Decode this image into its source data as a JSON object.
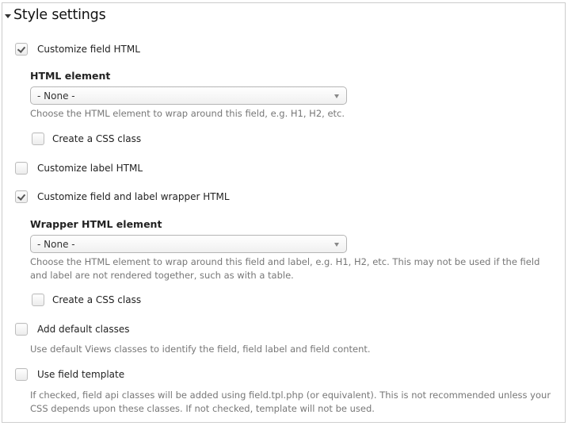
{
  "section": {
    "title": "Style settings",
    "expanded": true
  },
  "customize_field": {
    "label": "Customize field HTML",
    "checked": true,
    "element_label": "HTML element",
    "element_value": "- None -",
    "element_description": "Choose the HTML element to wrap around this field, e.g. H1, H2, etc.",
    "css_class_label": "Create a CSS class",
    "css_class_checked": false
  },
  "customize_label": {
    "label": "Customize label HTML",
    "checked": false
  },
  "customize_wrapper": {
    "label": "Customize field and label wrapper HTML",
    "checked": true,
    "element_label": "Wrapper HTML element",
    "element_value": "- None -",
    "element_description": "Choose the HTML element to wrap around this field and label, e.g. H1, H2, etc. This may not be used if the field and label are not rendered together, such as with a table.",
    "css_class_label": "Create a CSS class",
    "css_class_checked": false
  },
  "default_classes": {
    "label": "Add default classes",
    "checked": false,
    "description": "Use default Views classes to identify the field, field label and field content."
  },
  "field_template": {
    "label": "Use field template",
    "checked": false,
    "description": "If checked, field api classes will be added using field.tpl.php (or equivalent). This is not recommended unless your CSS depends upon these classes. If not checked, template will not be used."
  }
}
